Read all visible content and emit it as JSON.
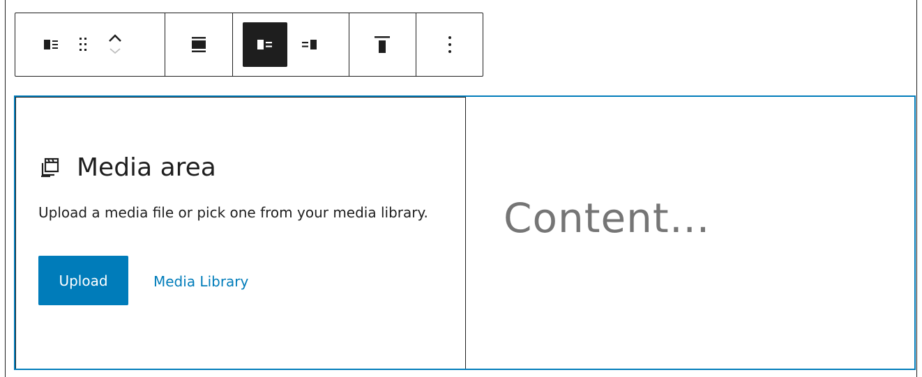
{
  "toolbar": {
    "block_type": {
      "icon": "media-text-icon",
      "label": "Media & Text"
    },
    "drag": {
      "icon": "drag-handle-icon",
      "label": "Drag"
    },
    "move_up": {
      "icon": "chevron-up-icon",
      "label": "Move up"
    },
    "move_down": {
      "icon": "chevron-down-icon",
      "label": "Move down"
    },
    "align": {
      "icon": "align-wide-icon",
      "label": "Align"
    },
    "media_left": {
      "icon": "media-left-icon",
      "label": "Show media on left",
      "active": true
    },
    "media_right": {
      "icon": "media-right-icon",
      "label": "Show media on right",
      "active": false
    },
    "vertical_align": {
      "icon": "align-top-icon",
      "label": "Change vertical alignment"
    },
    "options": {
      "icon": "more-vertical-icon",
      "label": "Options"
    }
  },
  "media": {
    "icon": "media-icon",
    "title": "Media area",
    "description": "Upload a media file or pick one from your media library.",
    "upload_label": "Upload",
    "library_label": "Media Library"
  },
  "content": {
    "placeholder": "Content…"
  },
  "colors": {
    "accent": "#007cba",
    "text": "#1e1e1e",
    "placeholder": "#757575"
  }
}
